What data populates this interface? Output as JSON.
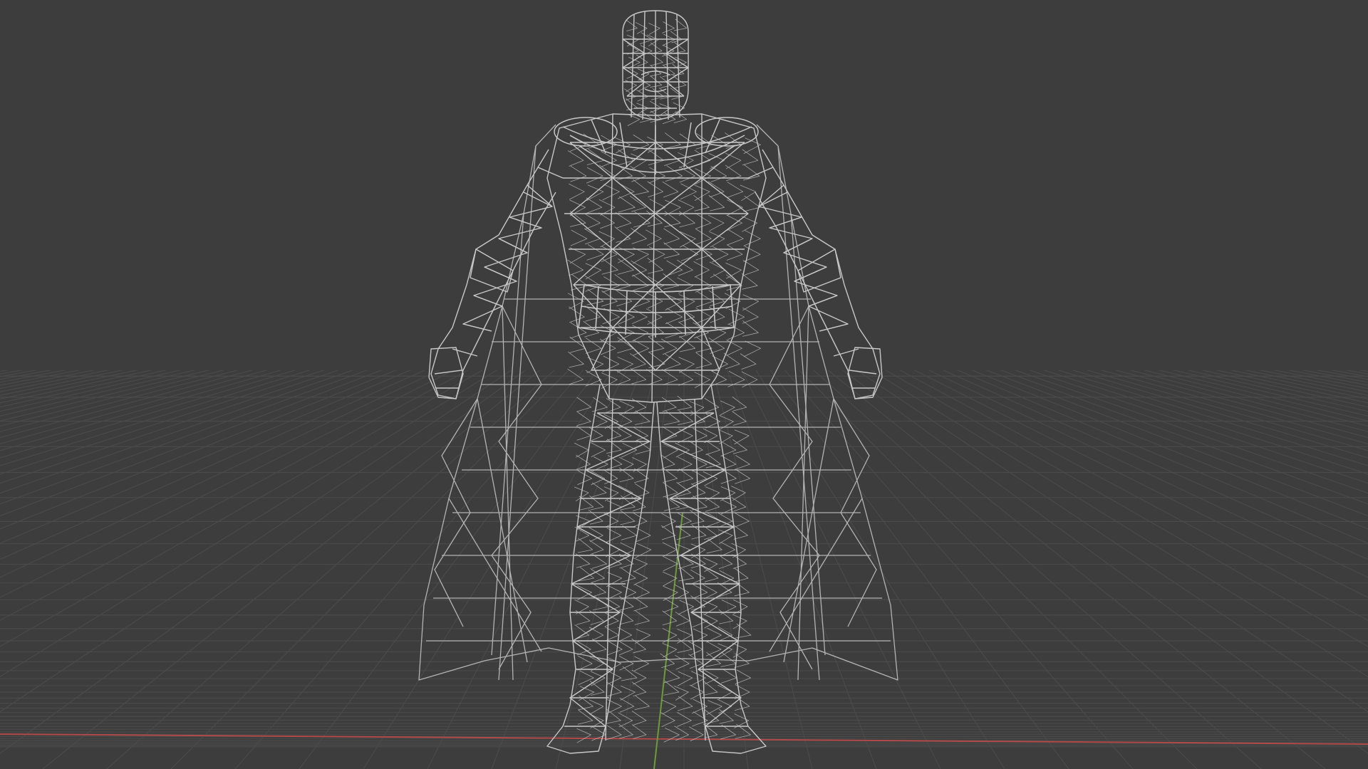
{
  "viewport": {
    "background": "#3d3d3d",
    "grid_color": "#4a4a4a",
    "wire_color": "#c8c8c8",
    "x_axis_color": "#b04a4a",
    "y_axis_color": "#6e9a3a",
    "object": "wireframe-character-with-cape",
    "shading_mode": "wireframe"
  }
}
